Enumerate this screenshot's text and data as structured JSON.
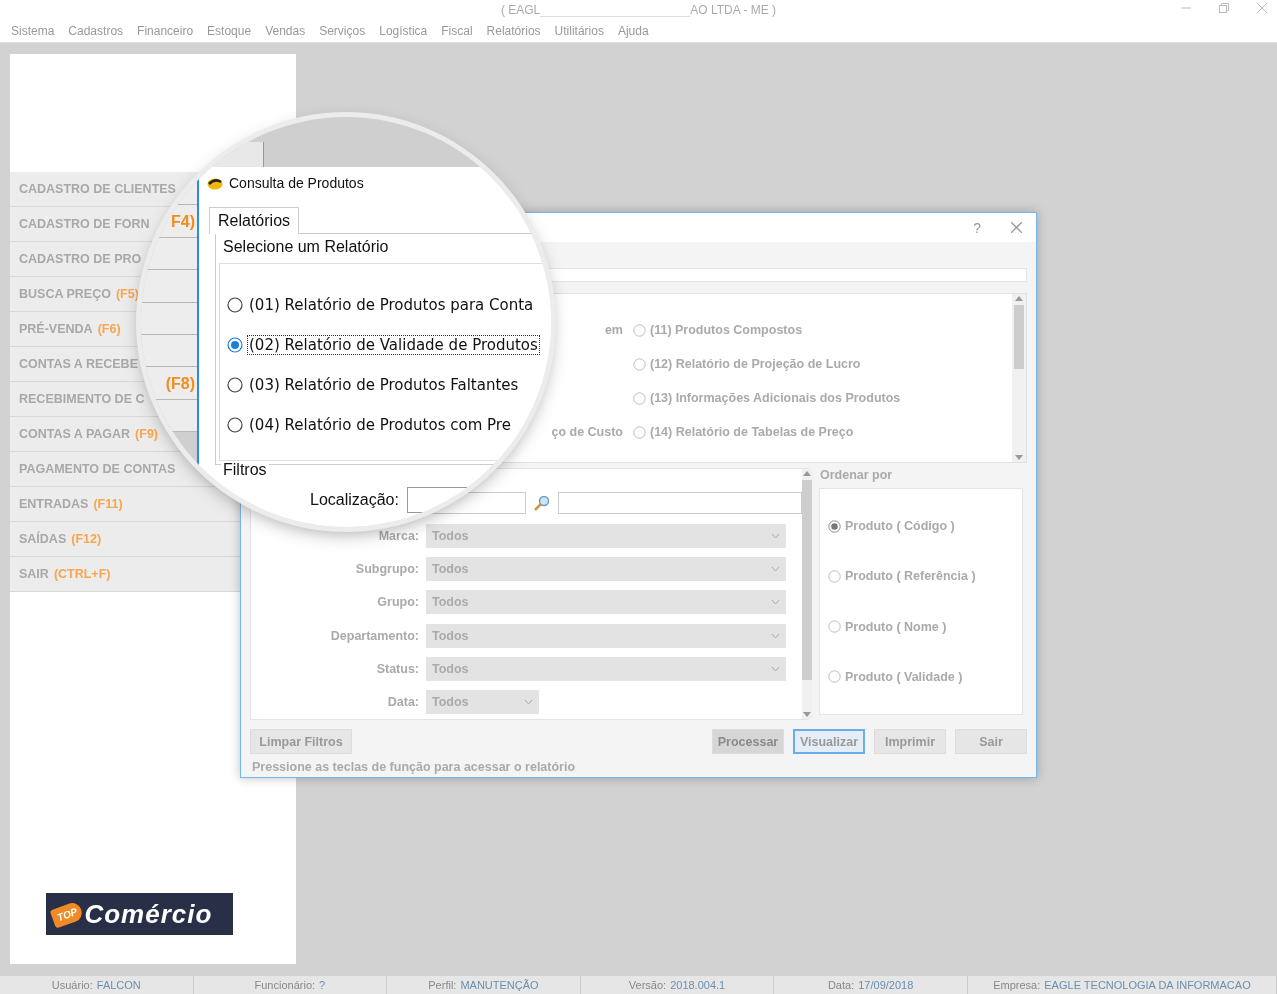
{
  "window": {
    "title_start": "( EAGL",
    "title_end": "AO LTDA - ME )"
  },
  "menu": [
    "Sistema",
    "Cadastros",
    "Financeiro",
    "Estoque",
    "Vendas",
    "Serviços",
    "Logística",
    "Fiscal",
    "Relatórios",
    "Utilitários",
    "Ajuda"
  ],
  "sidebar": [
    {
      "label": "CADASTRO DE CLIENTES"
    },
    {
      "label": "CADASTRO DE FORN"
    },
    {
      "label": "CADASTRO DE PRO"
    },
    {
      "label": "BUSCA PREÇO",
      "key": "(F5)"
    },
    {
      "label": "PRÉ-VENDA",
      "key": "(F6)"
    },
    {
      "label": "CONTAS A RECEBE"
    },
    {
      "label": "RECEBIMENTO DE C"
    },
    {
      "label": "CONTAS A PAGAR",
      "key": "(F9)"
    },
    {
      "label": "PAGAMENTO DE CONTAS"
    },
    {
      "label": "ENTRADAS",
      "key": "(F11)"
    },
    {
      "label": "SAÍDAS",
      "key": "(F12)"
    },
    {
      "label": "SAIR",
      "key": "(CTRL+F)"
    }
  ],
  "logo": {
    "badge": "TOP",
    "word": "Comércio"
  },
  "dialog": {
    "help": "?",
    "reports": [
      {
        "label": "(11) Produtos Compostos",
        "selected": false,
        "left_fragment": "em"
      },
      {
        "label": "(12) Relatório de Projeção de Lucro",
        "selected": false
      },
      {
        "label": "(13) Informações Adicionais dos Produtos",
        "selected": false
      },
      {
        "label": "(14) Relatório de Tabelas de Preço",
        "selected": false,
        "left_fragment": "ço de Custo"
      }
    ],
    "filters": [
      {
        "label": "Marca:",
        "value": "Todos"
      },
      {
        "label": "Subgrupo:",
        "value": "Todos"
      },
      {
        "label": "Grupo:",
        "value": "Todos"
      },
      {
        "label": "Departamento:",
        "value": "Todos"
      },
      {
        "label": "Status:",
        "value": "Todos"
      },
      {
        "label": "Data:",
        "value": "Todos",
        "kind": "short"
      }
    ],
    "order_title": "Ordenar por",
    "order_options": [
      {
        "label": "Produto ( Código )",
        "selected": true
      },
      {
        "label": "Produto ( Referência )",
        "selected": false
      },
      {
        "label": "Produto ( Nome )",
        "selected": false
      },
      {
        "label": "Produto ( Validade )",
        "selected": false
      }
    ],
    "clear_button": "Limpar Filtros",
    "buttons": [
      {
        "label": "Processar",
        "disabled": true,
        "focused": false
      },
      {
        "label": "Visualizar",
        "disabled": false,
        "focused": true
      },
      {
        "label": "Imprimir",
        "disabled": false,
        "focused": false
      },
      {
        "label": "Sair",
        "disabled": false,
        "focused": false
      }
    ],
    "hint": "Pressione as teclas de função para acessar o relatório"
  },
  "magnifier": {
    "sidebar_keys": [
      "F4)",
      "(F8)"
    ],
    "title": "Consulta de Produtos",
    "tab": "Relatórios",
    "group": "Selecione um Relatório",
    "reports": [
      {
        "label": "(01) Relatório de Produtos para Conta",
        "selected": false
      },
      {
        "label": "(02) Relatório de Validade de Produtos",
        "selected": true
      },
      {
        "label": "(03) Relatório de Produtos Faltantes",
        "selected": false
      },
      {
        "label": "(04) Relatório de Produtos com Pre",
        "selected": false
      }
    ],
    "filters_title": "Filtros",
    "location_label": "Localização:"
  },
  "status_bar": [
    {
      "label": "Usuário:",
      "value": "FALCON"
    },
    {
      "label": "Funcionário:",
      "value": "?"
    },
    {
      "label": "Perfil:",
      "value": "MANUTENÇÃO"
    },
    {
      "label": "Versão:",
      "value": "2018.004.1"
    },
    {
      "label": "Data:",
      "value": "17/09/2018"
    },
    {
      "label": "Empresa:",
      "value": "EAGLE TECNOLOGIA DA INFORMACAO"
    }
  ]
}
